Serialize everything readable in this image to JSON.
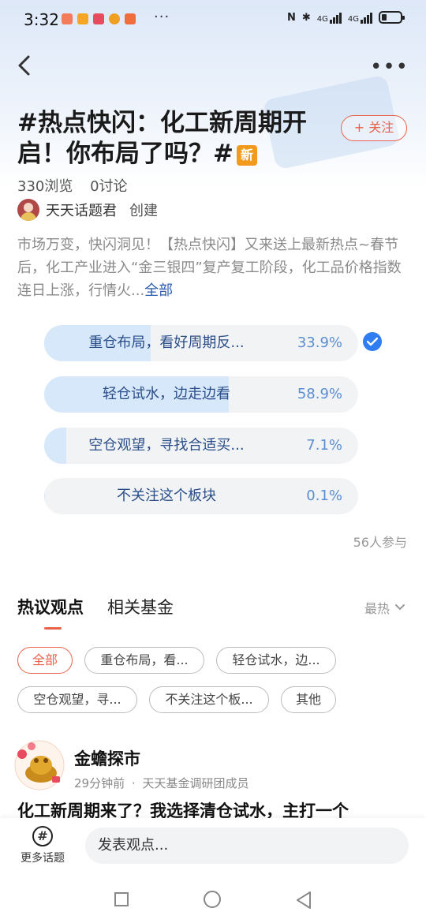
{
  "status_bar": {
    "time": "3:32",
    "more": "···",
    "net1": "4G",
    "net2": "4G"
  },
  "header": {
    "more": "•••"
  },
  "topic": {
    "title": "#热点快闪：化工新周期开启！你布局了吗？#",
    "new_badge": "新",
    "follow_label": "+ 关注",
    "views": "330浏览",
    "discussions": "0讨论",
    "creator_name": "天天话题君",
    "creator_role": "创建",
    "description": "市场万变，快闪洞见！【热点快闪】又来送上最新热点~春节后，化工产业进入“金三银四”复产复工阶段，化工品价格指数连日上涨，行情火...",
    "description_more": "全部"
  },
  "poll": {
    "options": [
      {
        "label": "重仓布局，看好周期反...",
        "pct_text": "33.9%",
        "pct": 33.9,
        "selected": true
      },
      {
        "label": "轻仓试水，边走边看",
        "pct_text": "58.9%",
        "pct": 58.9,
        "selected": false
      },
      {
        "label": "空仓观望，寻找合适买...",
        "pct_text": "7.1%",
        "pct": 7.1,
        "selected": false
      },
      {
        "label": "不关注这个板块",
        "pct_text": "0.1%",
        "pct": 0.1,
        "selected": false
      }
    ],
    "participants": "56人参与"
  },
  "tabs": {
    "hot_opinions": "热议观点",
    "related_funds": "相关基金",
    "sort_label": "最热"
  },
  "filters": {
    "chips": [
      "全部",
      "重仓布局，看...",
      "轻仓试水，边...",
      "空仓观望，寻...",
      "不关注这个板...",
      "其他"
    ]
  },
  "post": {
    "author": "金蟾探市",
    "time": "29分钟前",
    "separator": "·",
    "group": "天天基金调研团成员",
    "title": "化工新周期来了？我选择清仓试水，主打一个"
  },
  "bottom_bar": {
    "more_topics": "更多话题",
    "comment_placeholder": "发表观点..."
  },
  "colors": {
    "accent": "#e8624a",
    "poll_fill": "#d7e8fb",
    "link": "#2a5db0",
    "check": "#2f7df0",
    "badge": "#f29a1c"
  }
}
